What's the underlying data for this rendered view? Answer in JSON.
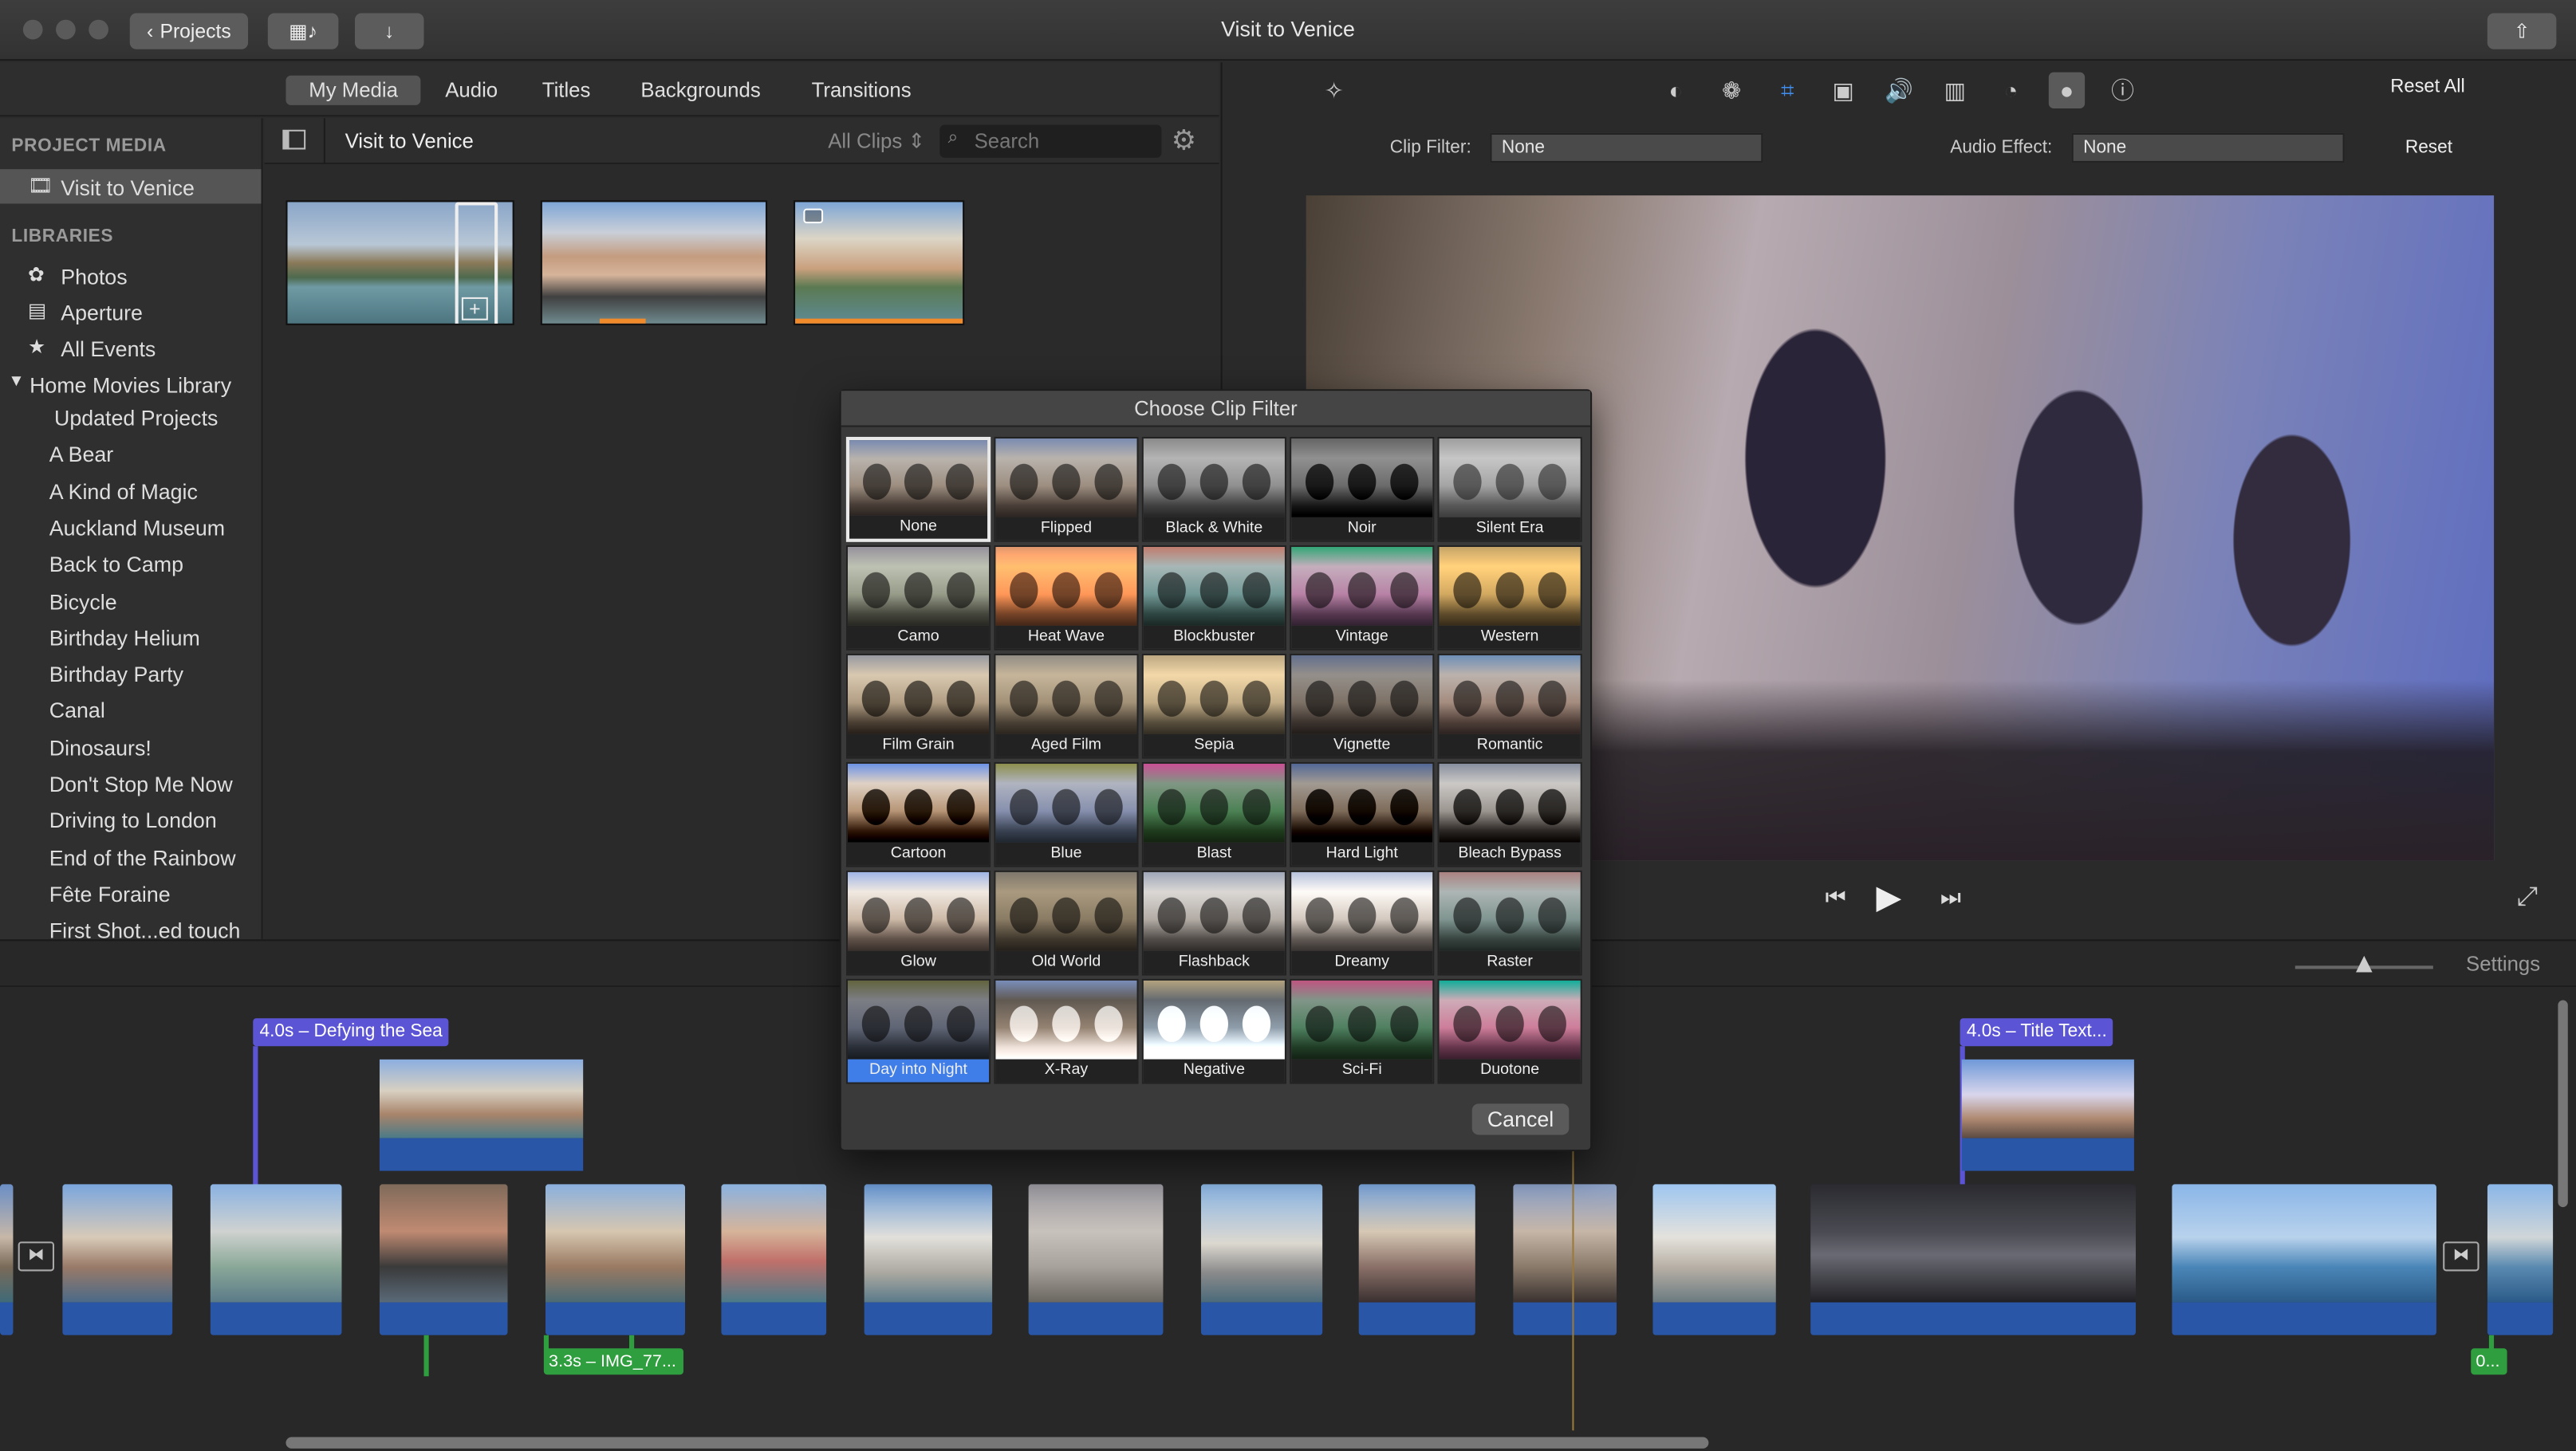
{
  "window": {
    "title": "Visit to Venice"
  },
  "toolbar": {
    "projects_label": "Projects"
  },
  "media_tabs": [
    "My Media",
    "Audio",
    "Titles",
    "Backgrounds",
    "Transitions"
  ],
  "sidebar": {
    "project_media_heading": "PROJECT MEDIA",
    "project_item": "Visit to Venice",
    "libraries_heading": "LIBRARIES",
    "libraries": [
      "Photos",
      "Aperture",
      "All Events"
    ],
    "library_name": "Home Movies Library",
    "events": [
      "Updated Projects",
      "A Bear",
      "A Kind of Magic",
      "Auckland Museum",
      "Back to Camp",
      "Bicycle",
      "Birthday Helium",
      "Birthday Party",
      "Canal",
      "Dinosaurs!",
      "Don't Stop Me Now",
      "Driving to London",
      "End of the Rainbow",
      "Fête Foraine",
      "First Shot...ed touch"
    ]
  },
  "browser": {
    "title": "Visit to Venice",
    "filter": "All Clips",
    "search_placeholder": "Search"
  },
  "inspector": {
    "reset_all": "Reset All",
    "clip_filter_label": "Clip Filter:",
    "clip_filter_value": "None",
    "audio_effect_label": "Audio Effect:",
    "audio_effect_value": "None",
    "reset": "Reset"
  },
  "dialog": {
    "title": "Choose Clip Filter",
    "cancel": "Cancel",
    "filters": [
      "None",
      "Flipped",
      "Black & White",
      "Noir",
      "Silent Era",
      "Camo",
      "Heat Wave",
      "Blockbuster",
      "Vintage",
      "Western",
      "Film Grain",
      "Aged Film",
      "Sepia",
      "Vignette",
      "Romantic",
      "Cartoon",
      "Blue",
      "Blast",
      "Hard Light",
      "Bleach Bypass",
      "Glow",
      "Old World",
      "Flashback",
      "Dreamy",
      "Raster",
      "Day into Night",
      "X-Ray",
      "Negative",
      "Sci-Fi",
      "Duotone"
    ],
    "selected": "None",
    "highlighted": "Day into Night"
  },
  "timeline": {
    "settings": "Settings",
    "title1": "4.0s – Defying the Sea",
    "title2": "4.0s – Title Text...",
    "audio1": "3.3s – IMG_77...",
    "audio2": "0..."
  },
  "colors": {
    "accent": "#3f7ee8",
    "title_clip": "#5b55d6",
    "audio_clip": "#2a56a8",
    "bg_music": "#2f9e3e"
  }
}
